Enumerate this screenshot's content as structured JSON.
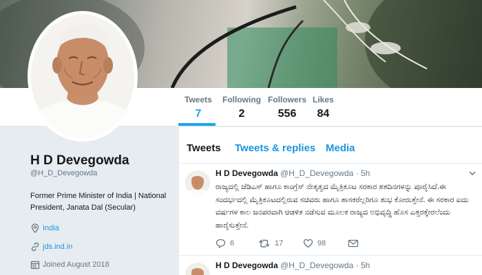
{
  "profile": {
    "name": "H D Devegowda",
    "handle": "@H_D_Devegowda",
    "bio": "Former Prime Minister of India | National President, Janata Dal (Secular)",
    "location": "India",
    "website": "jds.ind.in",
    "joined": "Joined August 2018"
  },
  "stats": [
    {
      "label": "Tweets",
      "value": "7"
    },
    {
      "label": "Following",
      "value": "2"
    },
    {
      "label": "Followers",
      "value": "556"
    },
    {
      "label": "Likes",
      "value": "84"
    }
  ],
  "tabs": [
    {
      "label": "Tweets"
    },
    {
      "label": "Tweets & replies"
    },
    {
      "label": "Media"
    }
  ],
  "tweets": [
    {
      "name": "H D Devegowda",
      "handle": "@H_D_Devegowda",
      "time": "· 5h",
      "text": "ರಾಜ್ಯದಲ್ಲಿ ಜೆಡಿಎಸ್ ಹಾಗೂ ಕಾಂಗ್ರೆಸ್ ನೇತೃತ್ವದ ಮೈತ್ರಿಕೂಟ ಸರಕಾರ ಶತದಿನಗಳನ್ನು ಪೂರೈಸಿದೆ.ಈ ಸಂದರ್ಭದಲ್ಲಿ ಮೈತ್ರಿಕೂಟದಲ್ಲಿರುವ ಸಚಿವರು ಹಾಗೂ ಶಾಸಕರೆಲ್ಲರಿಗೂ ಶುಭ ಕೋರುತ್ತೇನೆ. ಈ ಸರಕಾರ ಐದು ವರ್ಷಗಳ ಕಾಲ ಜನಪರವಾಗಿ ಆಡಳಿತ ನಡೆಸುವ ಮೂಲಕ ರಾಜ್ಯದ ಅಭಿವೃದ್ಧಿ ಹೊಸ ಎತ್ತರಕ್ಕೇರಲೆಂದು ಹಾರೈಸುತ್ತೇನೆ.",
      "replies": "6",
      "retweets": "17",
      "likes": "98"
    },
    {
      "name": "H D Devegowda",
      "handle": "@H_D_Devegowda",
      "time": "· 5h"
    }
  ]
}
